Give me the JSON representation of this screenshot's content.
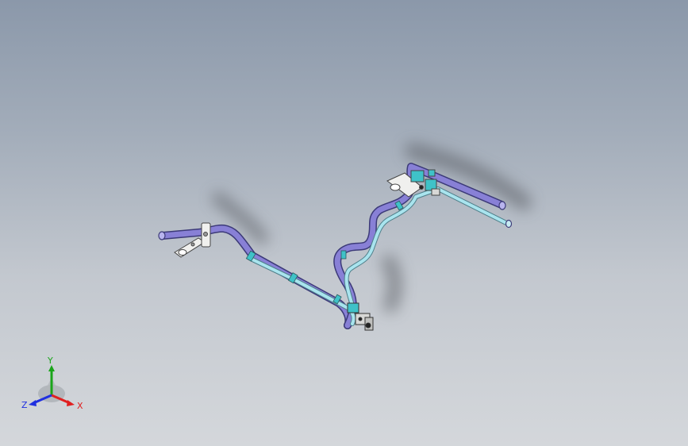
{
  "view": {
    "background_top": "#8b98aa",
    "background_bottom": "#d4d7db"
  },
  "model": {
    "tube_color": "#8880d6",
    "tube_alt_color": "#a9e4ee",
    "bracket_color": "#f0f0ee",
    "clip_color": "#3fc2c8",
    "shadow_color": "#55595f"
  },
  "triad": {
    "x_label": "X",
    "y_label": "Y",
    "z_label": "Z",
    "x_color": "#e02020",
    "y_color": "#1aa51a",
    "z_color": "#2030e0"
  }
}
